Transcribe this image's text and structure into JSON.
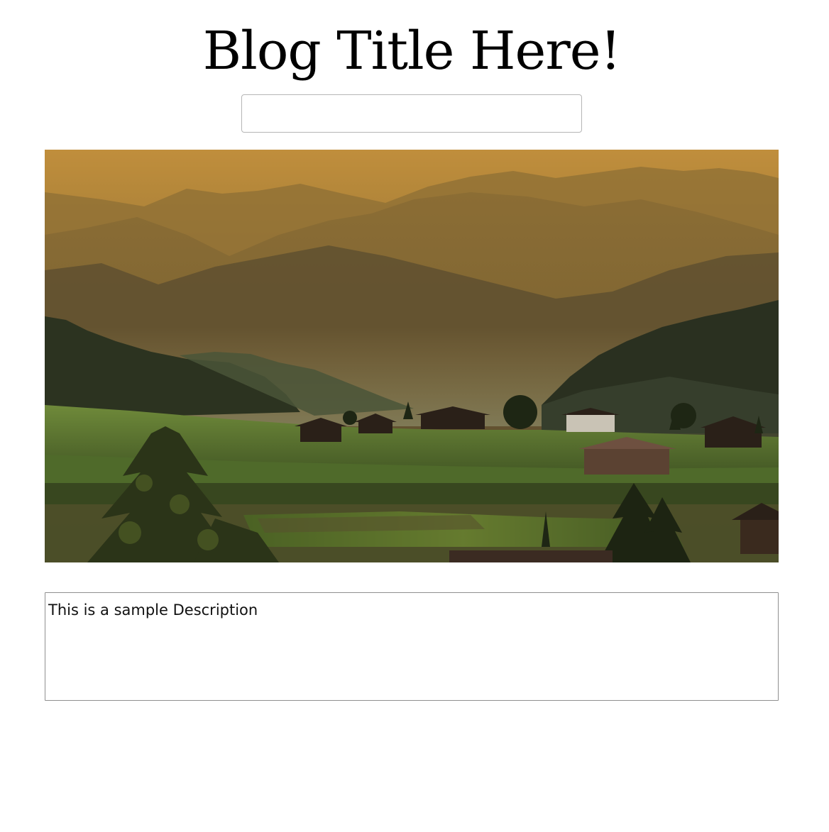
{
  "header": {
    "title": "Blog Title Here!"
  },
  "title_input": {
    "value": "",
    "placeholder": ""
  },
  "hero_image": {
    "subject": "mountain-village-landscape"
  },
  "description": {
    "value": "This is a sample Description"
  },
  "colors": {
    "sky_gold": "#b8893a",
    "mountain_haze": "#6e5a32",
    "field_green": "#5e7a2e",
    "tree_dark": "#1f2414"
  }
}
